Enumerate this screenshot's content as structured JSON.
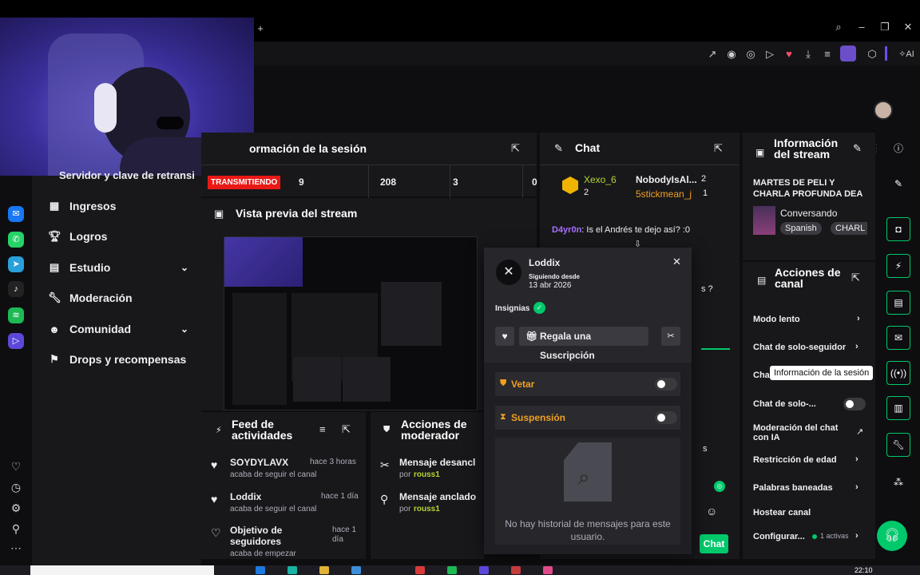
{
  "session": {
    "title": "ormación de la sesión",
    "live_badge": "TRANSMITIENDO",
    "stats": [
      "9",
      "208",
      "3",
      "0"
    ],
    "behind_text": "Servidor y clave de retransi"
  },
  "sidenav": {
    "items": [
      {
        "label": "Ingresos"
      },
      {
        "label": "Logros"
      },
      {
        "label": "Estudio"
      },
      {
        "label": "Moderación"
      },
      {
        "label": "Comunidad"
      },
      {
        "label": "Drops y recompensas"
      }
    ]
  },
  "preview": {
    "title": "Vista previa del stream"
  },
  "feed": {
    "title": "Feed de actividades",
    "items": [
      {
        "name": "SOYDYLAVX",
        "time": "hace 3 horas",
        "desc": "acaba de seguir el canal"
      },
      {
        "name": "Loddix",
        "time": "hace 1 día",
        "desc": "acaba de seguir el canal"
      },
      {
        "name": "Objetivo de seguidores",
        "time": "hace 1 día",
        "desc": "acaba de empezar"
      }
    ]
  },
  "mod_actions": {
    "title": "Acciones de moderador",
    "items": [
      {
        "action": "Mensaje desancl",
        "by_prefix": "por",
        "by": "rouss1"
      },
      {
        "action": "Mensaje anclado",
        "by_prefix": "por",
        "by": "rouss1"
      }
    ]
  },
  "chat": {
    "title": "Chat",
    "leaders": [
      {
        "name": "Xexo_6",
        "count": "2"
      },
      {
        "name": "NobodyIsAl...",
        "count": "2"
      },
      {
        "name": "5stickmean_j",
        "count": "1"
      }
    ],
    "message": {
      "user": "D4yr0n",
      "text": ": Is el Andrés te dejo así? :0"
    },
    "partial_text": "s ?",
    "partial_s": "s",
    "chat_button": "Chat"
  },
  "user_card": {
    "username": "Loddix",
    "following_label": "Siguiendo desde",
    "following_date": "13 abr 2026",
    "badges_label": "Insignias",
    "gift_button": "Regala una Suscripción",
    "ban_label": "Vetar",
    "timeout_label": "Suspensión",
    "empty_history": "No hay historial de mensajes para este usuario."
  },
  "stream_info": {
    "title": "Información del stream",
    "stream_title": "MARTES DE PELI Y CHARLA PROFUNDA DEA",
    "category": "Conversando",
    "tags": [
      "Spanish",
      "CHARL"
    ]
  },
  "channel_actions": {
    "title": "Acciones de canal",
    "items": [
      {
        "label": "Modo lento"
      },
      {
        "label": "Chat de solo-seguidor"
      },
      {
        "label": "Cha"
      },
      {
        "label": "Chat de solo-..."
      },
      {
        "label": "Moderación del chat con IA"
      },
      {
        "label": "Restricción de edad"
      },
      {
        "label": "Palabras baneadas"
      },
      {
        "label": "Hostear canal"
      },
      {
        "label": "Configurar..."
      }
    ],
    "config_badge": "1 activas"
  },
  "tooltip": "Información de la sesión",
  "taskbar": {
    "time": "22:10"
  },
  "colors": {
    "accent_green": "#00c96b",
    "live_red": "#e91916",
    "mod_orange": "#f0a020",
    "user_green": "#b5d534",
    "user_purple": "#a970ff"
  }
}
